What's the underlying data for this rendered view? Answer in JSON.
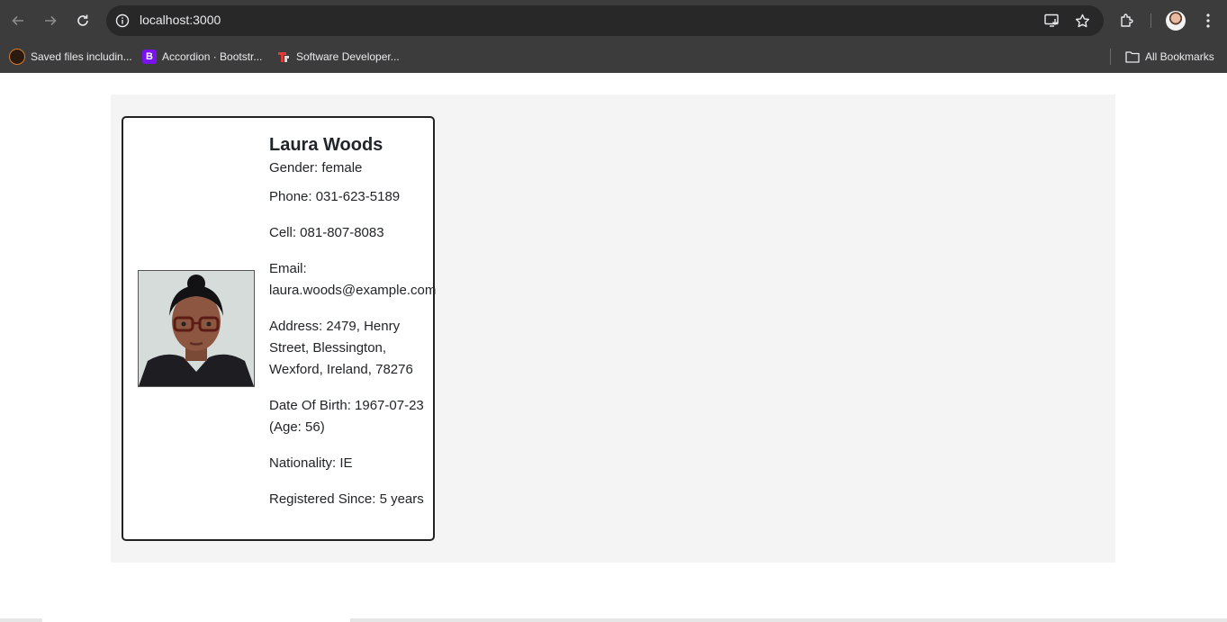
{
  "browser": {
    "url": "localhost:3000",
    "bookmarks": [
      {
        "label": "Saved files includin...",
        "icon": "saved-files-icon"
      },
      {
        "label": "Accordion · Bootstr...",
        "icon": "bootstrap-icon",
        "icon_text": "B"
      },
      {
        "label": "Software Developer...",
        "icon": "software-developer-icon"
      }
    ],
    "all_bookmarks": "All Bookmarks"
  },
  "profile": {
    "name": "Laura Woods",
    "gender": "Gender: female",
    "phone": "Phone: 031-623-5189",
    "cell": "Cell: 081-807-8083",
    "email_label": "Email:",
    "email": "laura.woods@example.com",
    "address_1": "Address: 2479, Henry",
    "address_2": "Street, Blessington,",
    "address_3": "Wexford, Ireland, 78276",
    "dob_1": "Date Of Birth: 1967-07-23",
    "dob_2": "(Age: 56)",
    "nationality": "Nationality: IE",
    "registered": "Registered Since: 5 years"
  },
  "colors": {
    "browser_frame": "#3c3c3c",
    "omnibox": "#282828",
    "panel_bg": "#f4f4f4",
    "card_border": "#222222",
    "text": "#212529"
  }
}
